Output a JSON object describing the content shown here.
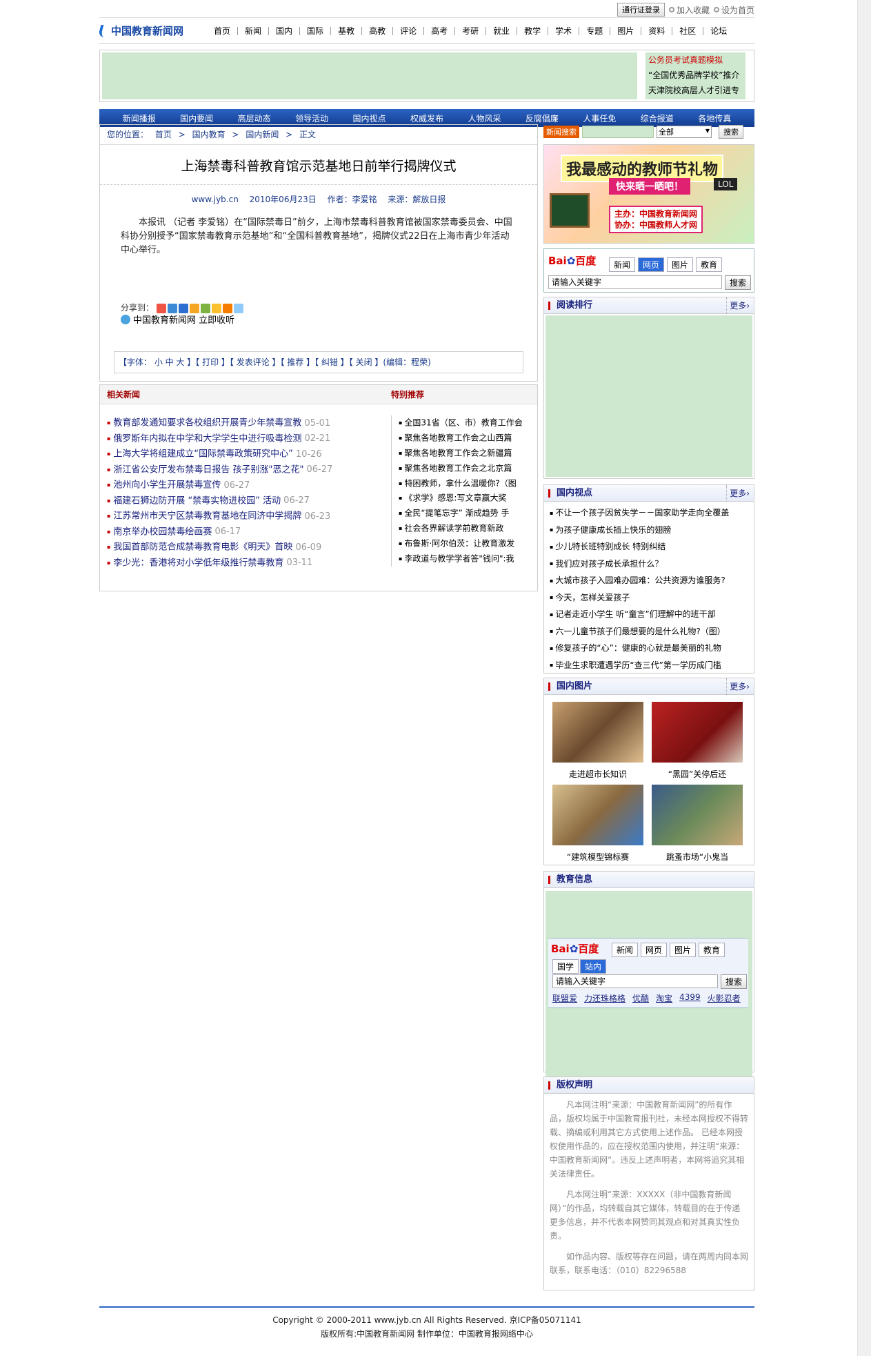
{
  "top": {
    "pass_login": "通行证登录",
    "bookmark": "加入收藏",
    "homepage": "设为首页"
  },
  "logo": {
    "text": "中国教育新闻网"
  },
  "mainnav": [
    "首页",
    "新闻",
    "国内",
    "国际",
    "基教",
    "高教",
    "评论",
    "高考",
    "考研",
    "就业",
    "教学",
    "学术",
    "专题",
    "图片",
    "资料",
    "社区",
    "论坛"
  ],
  "ad": {
    "links": [
      "公务员考试真题模拟",
      "“全国优秀品牌学校”推介",
      "天津院校高层人才引进专栏"
    ]
  },
  "subnav": [
    "新闻播报",
    "国内要闻",
    "高层动态",
    "领导活动",
    "国内视点",
    "权威发布",
    "人物风采",
    "反腐倡廉",
    "人事任免",
    "综合报道",
    "各地传真"
  ],
  "breadcrumb": {
    "label": "您的位置：",
    "items": [
      "首页",
      ">",
      "国内教育",
      ">",
      "国内新闻",
      ">",
      "正文"
    ]
  },
  "article": {
    "title": "上海禁毒科普教育馆示范基地日前举行揭牌仪式",
    "site": "www.jyb.cn",
    "date": "2010年06月23日",
    "author": "作者：李爱铭",
    "source": "来源：解放日报",
    "body": "本报讯 （记者 李爱铭）在“国际禁毒日”前夕，上海市禁毒科普教育馆被国家禁毒委员会、中国科协分别授予“国家禁毒教育示范基地”和“全国科普教育基地”，揭牌仪式22日在上海市青少年活动中心举行。",
    "share_label": "分享到：",
    "listen": "中国教育新闻网 立即收听",
    "toolbar": "【字体： 小   中   大  】【 打印 】【 发表评论 】【 推荐 】【 纠错 】【 关闭 】(编辑：程荣)"
  },
  "related": {
    "title": "相关新闻",
    "items": [
      {
        "text": "教育部发通知要求各校组织开展青少年禁毒宣教",
        "date": "05-01"
      },
      {
        "text": "俄罗斯年内拟在中学和大学学生中进行吸毒检测",
        "date": "02-21"
      },
      {
        "text": "上海大学将组建成立“国际禁毒政策研究中心”",
        "date": "10-26"
      },
      {
        "text": "浙江省公安厅发布禁毒日报告 孩子别涨\"恶之花\"",
        "date": "06-27"
      },
      {
        "text": "池州向小学生开展禁毒宣传",
        "date": "06-27"
      },
      {
        "text": "福建石狮边防开展 “禁毒实物进校园” 活动",
        "date": "06-27"
      },
      {
        "text": "江苏常州市天宁区禁毒教育基地在同济中学揭牌",
        "date": "06-23"
      },
      {
        "text": "南京举办校园禁毒绘画赛",
        "date": "06-17"
      },
      {
        "text": "我国首部防范合成禁毒教育电影《明天》首映",
        "date": "06-09"
      },
      {
        "text": "李少光：香港将对小学低年级推行禁毒教育",
        "date": "03-11"
      }
    ]
  },
  "special": {
    "title": "特别推荐",
    "items": [
      "全国31省（区、市）教育工作会",
      "聚焦各地教育工作会之山西篇",
      "聚焦各地教育工作会之新疆篇",
      "聚焦各地教育工作会之北京篇",
      "特困教师，拿什么温暖你?（图",
      "《求学》感恩:写文章赢大奖",
      "全民“提笔忘字” 渐成趋势 手",
      "社会各界解读学前教育新政",
      "布鲁斯·阿尔伯茨：让教育激发",
      "李政道与教学学者答\"钱问\":我"
    ]
  },
  "search": {
    "label": "新闻搜索",
    "select": "全部",
    "button": "搜索"
  },
  "banner": {
    "headline": "我最感动的教师节礼物",
    "sub": "快来晒一晒吧！",
    "lol": "LOL",
    "host": "主办：中国教育新闻网",
    "co": "协办：中国教师人才网"
  },
  "baidu": {
    "logo_a": "Bai",
    "logo_b": "百度",
    "tabs": [
      "新闻",
      "网页",
      "图片",
      "教育"
    ],
    "placeholder": "请输入关键字",
    "button": "搜索"
  },
  "rank": {
    "title": "阅读排行",
    "more": "更多›"
  },
  "view": {
    "title": "国内视点",
    "more": "更多›",
    "items": [
      "不让一个孩子因贫失学－－国家助学走向全覆盖",
      "为孩子健康成长插上快乐的翅膀",
      "少儿特长班特别成长 特别纠结",
      "我们应对孩子成长承担什么？",
      "大城市孩子入园难办园难：公共资源为谁服务?",
      "今天，怎样关爱孩子",
      "记者走近小学生 听“童言”们理解中的班干部",
      "六一儿童节孩子们最想要的是什么礼物?（图）",
      "修复孩子的“心”：健康的心就是最美丽的礼物",
      "毕业生求职遭遇学历“查三代”第一学历成门槛"
    ]
  },
  "pics": {
    "title": "国内图片",
    "more": "更多›",
    "items": [
      "走进超市长知识",
      "“黑园”关停后还",
      "“建筑模型锦标赛",
      "跳蚤市场“小鬼当"
    ]
  },
  "info": {
    "title": "教育信息",
    "tabs": [
      "新闻",
      "网页",
      "图片",
      "教育"
    ],
    "tabs2": [
      "国学",
      "站内"
    ],
    "placeholder": "请输入关键字",
    "button": "搜索",
    "links": [
      "联盟爱",
      "力还珠格格",
      "优酷",
      "淘宝",
      "4399",
      "火影忍者"
    ]
  },
  "copyright": {
    "title": "版权声明",
    "paras": [
      "凡本网注明“来源：中国教育新闻网”的所有作品，版权均属于中国教育报刊社，未经本网授权不得转载、摘编或利用其它方式使用上述作品。 已经本网授权使用作品的，应在授权范围内使用，并注明“来源：中国教育新闻网”。违反上述声明者，本网将追究其相关法律责任。",
      "凡本网注明“来源：XXXXX（非中国教育新闻网）”的作品，均转载自其它媒体，转载目的在于传递更多信息，并不代表本网赞同其观点和对其真实性负责。",
      "如作品内容、版权等存在问题，请在两周内同本网联系，联系电话：（010）82296588"
    ]
  },
  "footer": {
    "line1": "Copyright © 2000-2011 www.jyb.cn All Rights Reserved. 京ICP备05071141",
    "line2": "版权所有:中国教育新闻网 制作单位：中国教育报网络中心"
  },
  "colors": {
    "nav_blue": "#1a4aa6",
    "ad_green": "#cde8cf",
    "accent_red": "#cc0000"
  }
}
